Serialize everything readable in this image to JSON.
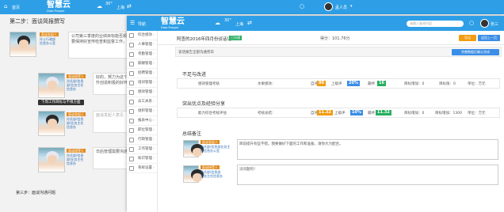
{
  "back": {
    "home_label": "首页",
    "logo_main": "智慧云",
    "logo_sub": "Data Prosper",
    "weather_temp": "30°",
    "weather_city": "上海",
    "user_name": "孟人员",
    "step_title": "第二步：面谈简报撰写",
    "person1": {
      "badge": "面谈发起人",
      "line1": "孙士行政部",
      "line2": "信息办公室"
    },
    "bubble1": "公司第三季度的业绩目标能否顺利完成，办公室要保持好宣传检查和监督工作。",
    "person2": {
      "badge": "面谈接受人",
      "line1": "孙氏部/信息",
      "line2": "部/业务主任",
      "line3": "信息办"
    },
    "bubble2": "好的，努力为这个项目完成业绩提升创造积极的好环境提升环境。",
    "tooltip": "下周工作目标与不限方面",
    "person3": {
      "badge": "面谈发起人",
      "line1": "孙氏部/信息",
      "line2": "部/业务主任",
      "line3": "信息办"
    },
    "bubble3_placeholder": "面谈发起人意见",
    "person4": {
      "badge": "面谈接受人",
      "line1": "孙氏部/信息",
      "line2": "部/业务主任",
      "line3": "信息办"
    },
    "bubble4": "日后管理需要沟通",
    "step3_title": "第三步：面谈沟通问题"
  },
  "front": {
    "menu_label": "导航",
    "logo_main": "智慧云",
    "logo_sub": "Data Prosper",
    "weather_temp": "30°",
    "weather_city": "上海",
    "search_placeholder": "请输入查询内容",
    "user_name": "张三",
    "sidebar": [
      "综合绩效",
      "人事管理",
      "考勤管理",
      "薪酬管理",
      "招聘管理",
      "培训管理",
      "绩效管理",
      "员工关系",
      "组织管理",
      "报表中心",
      "职位管理",
      "行政管理",
      "工作管理",
      "知识管理",
      "系统设置"
    ],
    "record_title": "阿查的2016年四月份谈话记",
    "status_chip": "已沟通",
    "score_label": "得分：101.76分",
    "btn_export": "导出",
    "btn_back": "返回上一页",
    "subbar_label": "谈话报告全部沟通完毕",
    "btn_confirm": "完善数据后确认完成",
    "section1_title": "不足与改进",
    "row1": {
      "name": "绩效管理考核",
      "assessor": "水果绩效：",
      "c1_label": "自评",
      "c1_value": "80",
      "c2_label": "上级评",
      "c2_value": "20%",
      "c3_label": "最终",
      "c3_value": "16",
      "weight": "目标增加：0",
      "target": "目标值：0",
      "unit": "单位：万元"
    },
    "section2_title": "突出优点及经验分享",
    "row2": {
      "name": "能力综合考核评估",
      "assessor": "考核总结：",
      "c1_label": "自评",
      "c1_value": "11.32",
      "c2_label": "上级评",
      "c2_value": "10%",
      "c3_label": "最终",
      "c3_value": "11.32",
      "weight": "目标增加：0",
      "target": "目标增加：1300",
      "unit": "单位：万元"
    },
    "section3_title": "总结备注",
    "comment1": {
      "badge": "面谈发起人",
      "line1": "孙氏部/信息部业务主",
      "line2": "任信息办公室",
      "text": "目前提升有些不错，我要做好下面的工作和准备，请你大力配合。"
    },
    "comment2": {
      "badge": "面谈接受人",
      "line1": "孙氏部/信息部",
      "line2": "业务主任信息办",
      "text": "没问题的！"
    }
  },
  "colors": {
    "brand": "#2e9fe6",
    "orange": "#f39c12",
    "blue": "#3a8ee6",
    "green": "#27ae60",
    "badge": "#e08b1f"
  }
}
